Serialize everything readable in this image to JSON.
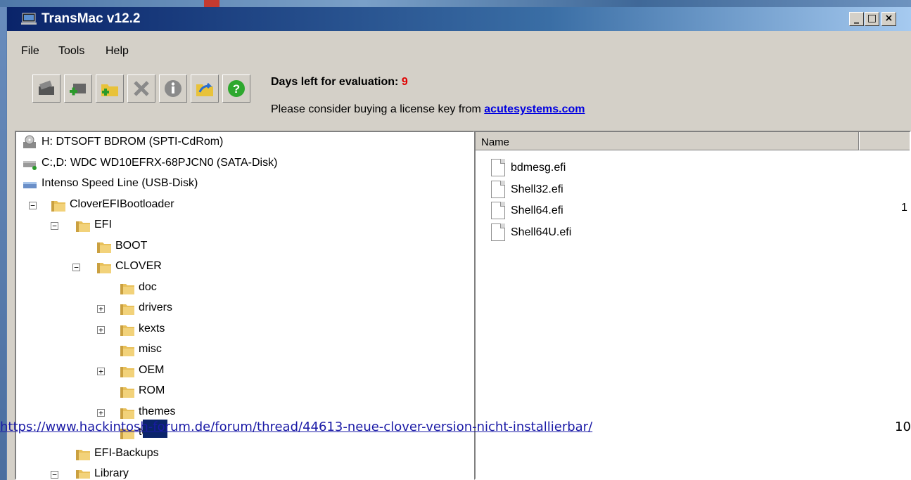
{
  "window": {
    "title": "TransMac v12.2",
    "controls": [
      "_",
      "□",
      "×"
    ]
  },
  "menu": [
    "File",
    "Tools",
    "Help"
  ],
  "toolbar": {
    "buttons": [
      "open-image-icon",
      "add-disk-icon",
      "new-folder-icon",
      "delete-icon",
      "info-icon",
      "folder-open-icon",
      "help-icon"
    ]
  },
  "evaluation": {
    "label": "Days left for evaluation:",
    "days": "9",
    "license_prefix": "Please consider buying a license key from",
    "license_link": "acutesystems.com"
  },
  "tree": [
    {
      "label": "H: DTSOFT BDROM (SPTI-CdRom)",
      "icon": "cdrom-drive-icon",
      "level": 0
    },
    {
      "label": "C:,D:  WDC WD10EFRX-68PJCN0 (SATA-Disk)",
      "icon": "hard-disk-icon",
      "level": 0
    },
    {
      "label": "Intenso Speed Line (USB-Disk)",
      "icon": "usb-disk-icon",
      "level": 0
    },
    {
      "label": "CloverEFIBootloader",
      "icon": "folder-icon",
      "level": 1,
      "expander": "⊟"
    },
    {
      "label": "EFI",
      "icon": "folder-icon",
      "level": 2,
      "expander": "⊟"
    },
    {
      "label": "BOOT",
      "icon": "folder-icon",
      "level": 3
    },
    {
      "label": "CLOVER",
      "icon": "folder-icon",
      "level": 3,
      "expander": "⊟"
    },
    {
      "label": "doc",
      "icon": "folder-icon",
      "level": 4
    },
    {
      "label": "drivers",
      "icon": "folder-icon",
      "level": 4,
      "expander": "⊞"
    },
    {
      "label": "kexts",
      "icon": "folder-icon",
      "level": 4,
      "expander": "⊞"
    },
    {
      "label": "misc",
      "icon": "folder-icon",
      "level": 4
    },
    {
      "label": "OEM",
      "icon": "folder-icon",
      "level": 4,
      "expander": "⊞"
    },
    {
      "label": "ROM",
      "icon": "folder-icon",
      "level": 4
    },
    {
      "label": "themes",
      "icon": "folder-icon",
      "level": 4,
      "expander": "⊞"
    },
    {
      "label": "tools",
      "icon": "folder-icon",
      "level": 4,
      "selected": true
    },
    {
      "label": "EFI-Backups",
      "icon": "folder-icon",
      "level": 2
    },
    {
      "label": "Library",
      "icon": "folder-icon",
      "level": 2,
      "expander": "⊟"
    }
  ],
  "filelist": {
    "column": "Name",
    "files": [
      "bdmesg.efi",
      "Shell32.efi",
      "Shell64.efi",
      "Shell64U.efi"
    ],
    "clipped_value": "1"
  },
  "watermark": {
    "url": "https://www.hackintosh-forum.de/forum/thread/44613-neue-clover-version-nicht-installierbar/",
    "number": "10"
  },
  "colors": {
    "title_gradient_start": "#0a246a",
    "title_gradient_end": "#a6caf0",
    "chrome": "#d4d0c8",
    "eval_days": "#e00000",
    "link": "#0000e0"
  }
}
